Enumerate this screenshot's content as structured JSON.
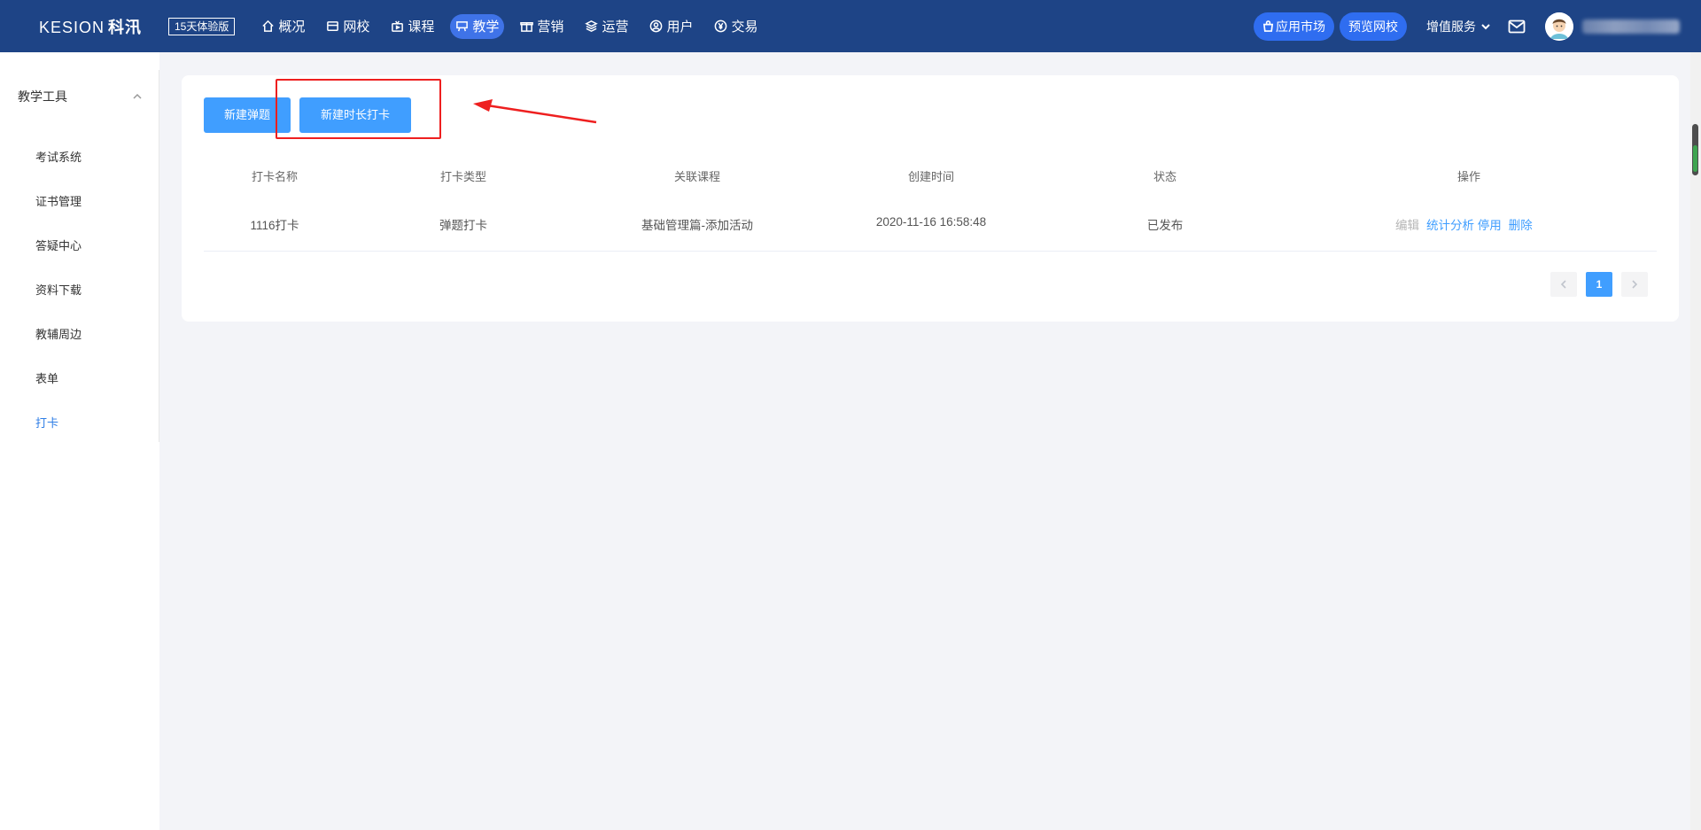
{
  "header": {
    "logo_text": "KESION",
    "logo_cn": "科汛",
    "trial_badge": "15天体验版",
    "nav": [
      {
        "label": "概况",
        "icon": "home-icon"
      },
      {
        "label": "网校",
        "icon": "school-icon"
      },
      {
        "label": "课程",
        "icon": "course-icon"
      },
      {
        "label": "教学",
        "icon": "teaching-icon",
        "active": true
      },
      {
        "label": "营销",
        "icon": "gift-icon"
      },
      {
        "label": "运营",
        "icon": "layers-icon"
      },
      {
        "label": "用户",
        "icon": "user-icon"
      },
      {
        "label": "交易",
        "icon": "yen-icon"
      }
    ],
    "app_market": "应用市场",
    "preview_school": "预览网校",
    "value_service": "增值服务"
  },
  "sidebar": {
    "group_label": "教学工具",
    "items": [
      {
        "label": "考试系统"
      },
      {
        "label": "证书管理"
      },
      {
        "label": "答疑中心"
      },
      {
        "label": "资料下载"
      },
      {
        "label": "教辅周边"
      },
      {
        "label": "表单"
      },
      {
        "label": "打卡",
        "active": true
      }
    ]
  },
  "main": {
    "buttons": {
      "new_popup": "新建弹题",
      "new_duration_checkin": "新建时长打卡"
    },
    "table": {
      "headers": [
        "打卡名称",
        "打卡类型",
        "关联课程",
        "创建时间",
        "状态",
        "操作"
      ],
      "rows": [
        {
          "name": "1116打卡",
          "type": "弹题打卡",
          "course": "基础管理篇-添加活动",
          "created": "2020-11-16 16:58:48",
          "status": "已发布",
          "actions": {
            "edit": "编辑",
            "stats": "统计分析",
            "disable": "停用",
            "delete": "删除"
          }
        }
      ]
    },
    "pagination": {
      "current": "1"
    }
  },
  "colors": {
    "topbar": "#1e4486",
    "nav_active": "#3f73e8",
    "primary": "#409eff",
    "annotation": "#ee1f1f"
  }
}
